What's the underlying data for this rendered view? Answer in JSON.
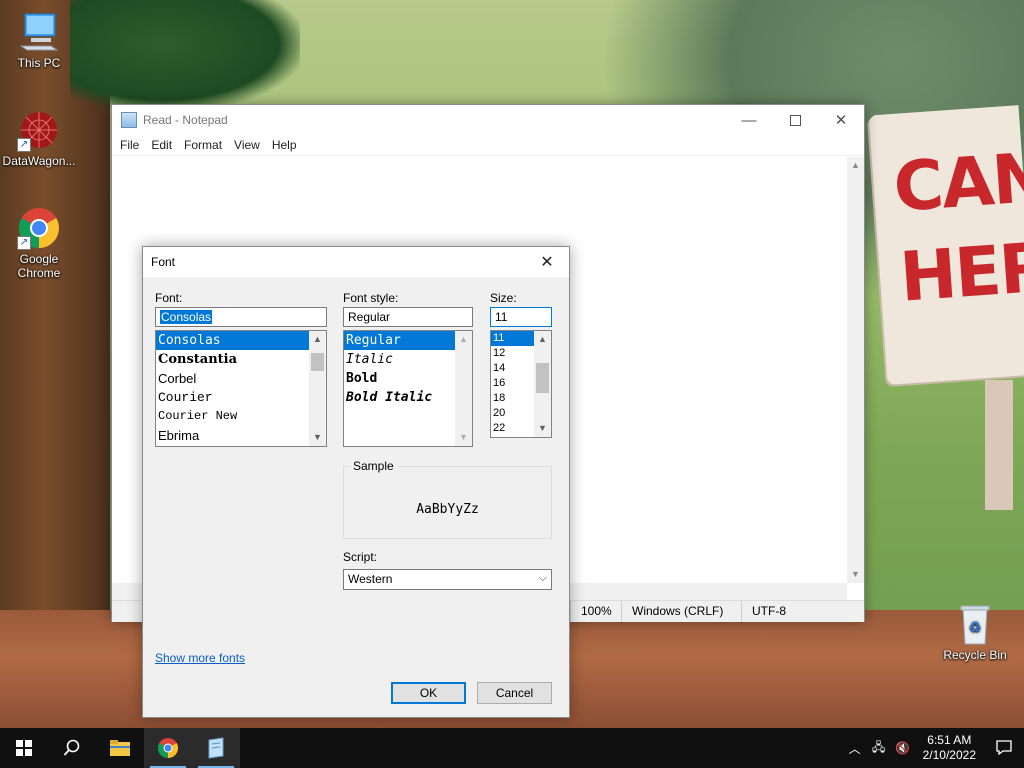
{
  "desktop": {
    "icons": [
      {
        "label": "This PC"
      },
      {
        "label": "DataWagon..."
      },
      {
        "label": "Google Chrome"
      },
      {
        "label": "Recycle Bin"
      }
    ],
    "sign_text": "CAN\nHER"
  },
  "notepad": {
    "title": "Read - Notepad",
    "menu": [
      "File",
      "Edit",
      "Format",
      "View",
      "Help"
    ],
    "status": {
      "zoom": "100%",
      "line_ending": "Windows (CRLF)",
      "encoding": "UTF-8"
    }
  },
  "font_dialog": {
    "title": "Font",
    "font_label": "Font:",
    "font_value": "Consolas",
    "fonts": [
      "Consolas",
      "Constantia",
      "Corbel",
      "Courier",
      "Courier New",
      "Ebrima"
    ],
    "style_label": "Font style:",
    "style_value": "Regular",
    "styles": [
      "Regular",
      "Italic",
      "Bold",
      "Bold Italic"
    ],
    "size_label": "Size:",
    "size_value": "11",
    "sizes": [
      "11",
      "12",
      "14",
      "16",
      "18",
      "20",
      "22"
    ],
    "sample_label": "Sample",
    "sample_text": "AaBbYyZz",
    "script_label": "Script:",
    "script_value": "Western",
    "show_more_fonts": "Show more fonts",
    "ok_label": "OK",
    "cancel_label": "Cancel"
  },
  "taskbar": {
    "time": "6:51 AM",
    "date": "2/10/2022"
  },
  "colors": {
    "accent": "#0078d7",
    "link": "#0a5ec2",
    "taskbar": "#101010"
  }
}
